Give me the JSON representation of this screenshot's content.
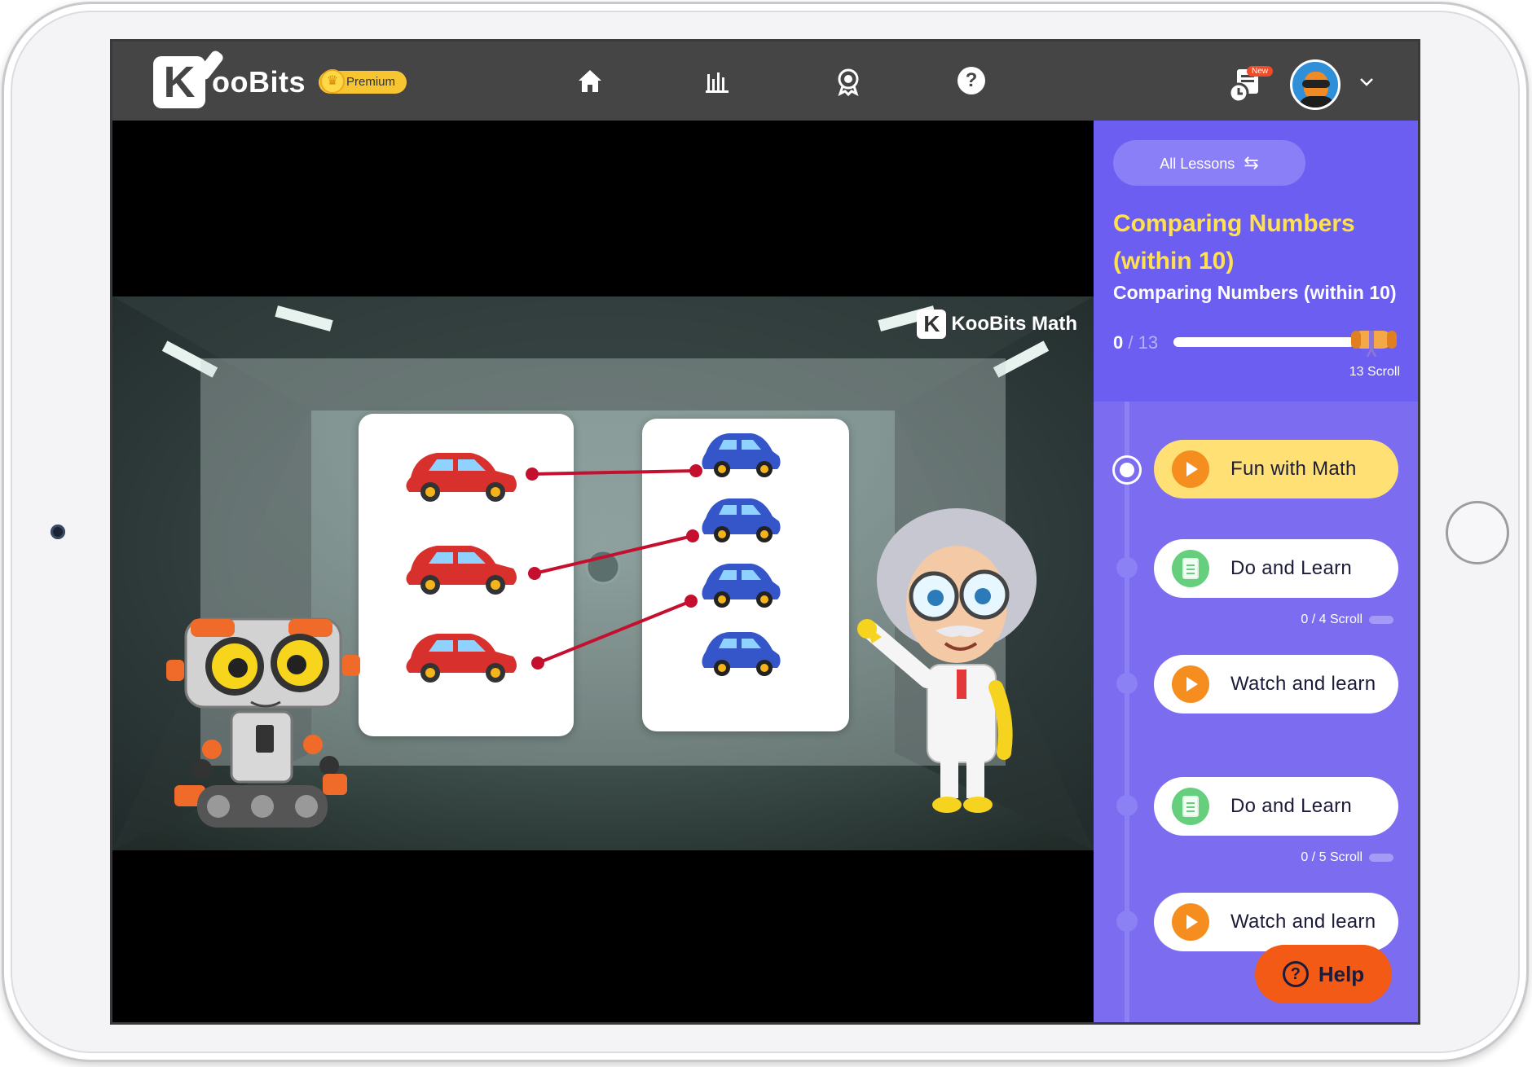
{
  "header": {
    "brand": "KooBits",
    "premium_label": "Premium",
    "notification_badge": "New",
    "nav": [
      {
        "name": "home",
        "icon": "home-icon"
      },
      {
        "name": "stats",
        "icon": "bar-chart-icon"
      },
      {
        "name": "achievements",
        "icon": "badge-icon"
      },
      {
        "name": "help",
        "icon": "question-icon",
        "glyph": "?"
      }
    ]
  },
  "video": {
    "watermark": "KooBits Math",
    "watermark_sup": "®"
  },
  "sidebar": {
    "all_lessons_label": "All Lessons",
    "lesson_title": "Comparing Numbers (within 10)",
    "lesson_subtitle": "Comparing Numbers (within 10)",
    "progress_done": "0",
    "progress_total": "/ 13",
    "scroll_count": "13 Scroll",
    "activities": [
      {
        "label": "Fun with Math",
        "type": "video",
        "active": true,
        "progress": ""
      },
      {
        "label": "Do and Learn",
        "type": "practice",
        "active": false,
        "progress": "0 / 4 Scroll"
      },
      {
        "label": "Watch and learn",
        "type": "video",
        "active": false,
        "progress": ""
      },
      {
        "label": "Do and Learn",
        "type": "practice",
        "active": false,
        "progress": "0 / 5 Scroll"
      },
      {
        "label": "Watch and learn",
        "type": "video",
        "active": false,
        "progress": ""
      }
    ]
  },
  "help_button_label": "Help",
  "colors": {
    "header_bg": "#454545",
    "sidebar_bg": "#7b6cf0",
    "lesson_title": "#ffe14d",
    "active_activity": "#ffe074",
    "help_button": "#f25a15"
  }
}
